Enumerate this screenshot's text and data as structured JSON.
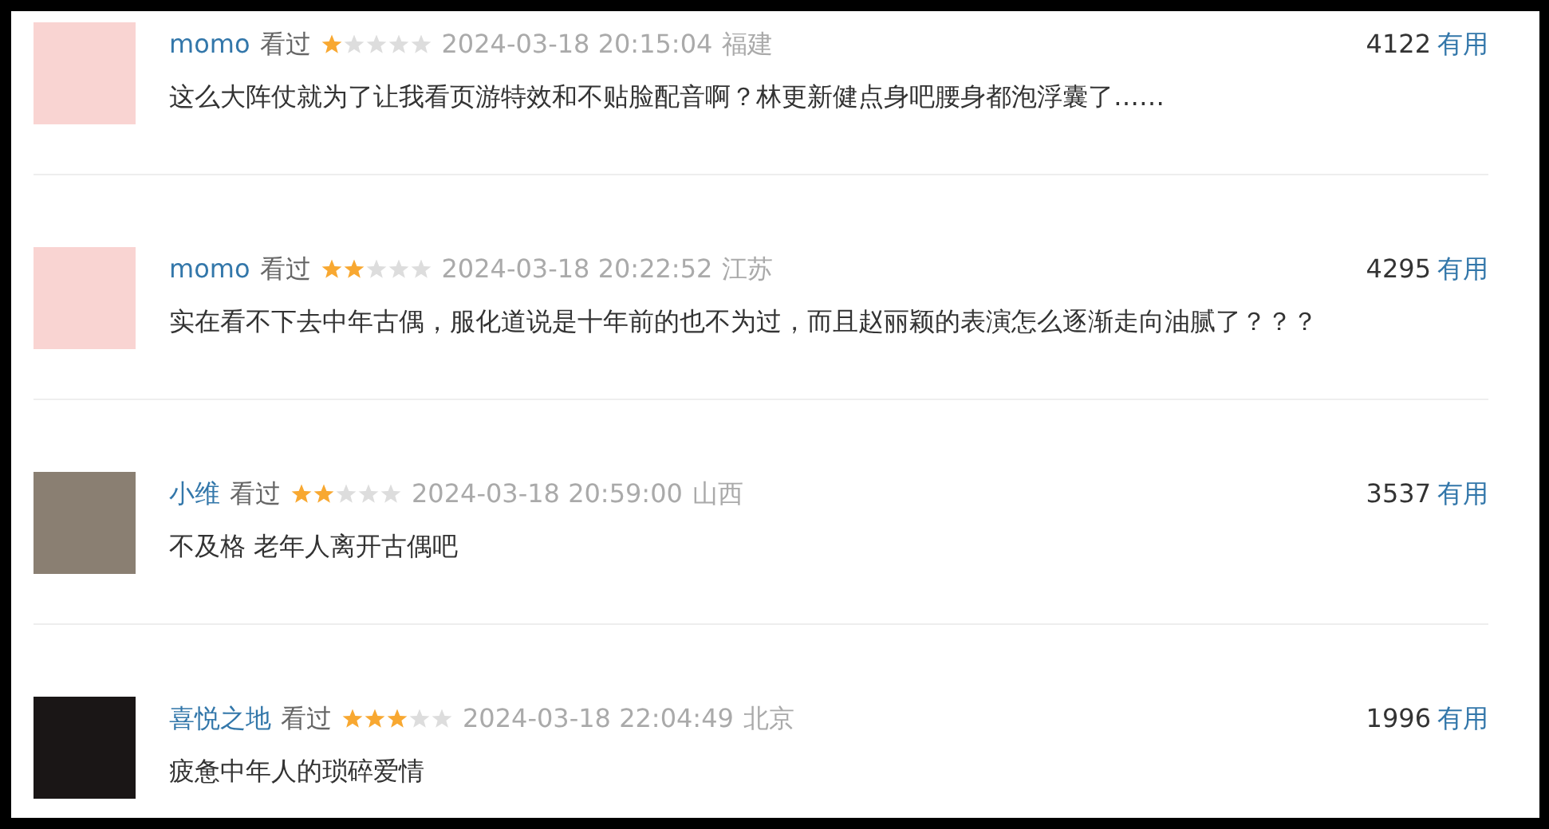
{
  "reviews": [
    {
      "kind": "pink",
      "user": "momo",
      "status": "看过",
      "stars": 1,
      "time": "2024-03-18 20:15:04",
      "region": "福建",
      "votes": "4122",
      "vote_label": "有用",
      "comment": "这么大阵仗就为了让我看页游特效和不贴脸配音啊？林更新健点身吧腰身都泡浮囊了……"
    },
    {
      "kind": "pink",
      "user": "momo",
      "status": "看过",
      "stars": 2,
      "time": "2024-03-18 20:22:52",
      "region": "江苏",
      "votes": "4295",
      "vote_label": "有用",
      "comment": "实在看不下去中年古偶，服化道说是十年前的也不为过，而且赵丽颖的表演怎么逐渐走向油腻了？？？"
    },
    {
      "kind": "photo",
      "user": "小维",
      "status": "看过",
      "stars": 2,
      "time": "2024-03-18 20:59:00",
      "region": "山西",
      "votes": "3537",
      "vote_label": "有用",
      "comment": "不及格 老年人离开古偶吧"
    },
    {
      "kind": "dark",
      "user": "喜悦之地",
      "status": "看过",
      "stars": 3,
      "time": "2024-03-18 22:04:49",
      "region": "北京",
      "votes": "1996",
      "vote_label": "有用",
      "comment": "疲惫中年人的琐碎爱情"
    }
  ]
}
